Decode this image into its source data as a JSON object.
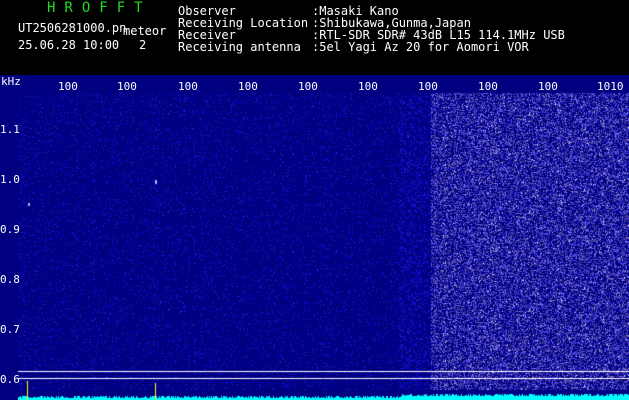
{
  "header": {
    "logo": "HROFFT",
    "filename": "UT2506281000.pn",
    "meteor_label": "meteor",
    "datetime": "25.06.28 10:00",
    "meteor_count": "2",
    "info": [
      {
        "label": "Observer",
        "value": ":Masaki Kano"
      },
      {
        "label": "Receiving Location",
        "value": ":Shibukawa,Gunma,Japan"
      },
      {
        "label": "Receiver",
        "value": ":RTL-SDR SDR# 43dB L15 114.1MHz USB"
      },
      {
        "label": "Receiving antenna",
        "value": ":5el Yagi Az 20 for Aomori VOR"
      }
    ]
  },
  "plot": {
    "unit_label": "kHz",
    "y_ticks": [
      "1.1",
      "1.0",
      "0.9",
      "0.8",
      "0.7",
      "0.6"
    ],
    "x_ticks": [
      "100",
      "100",
      "100",
      "100",
      "100",
      "100",
      "100",
      "100",
      "100",
      "1010"
    ],
    "colors": {
      "background": "#000080",
      "noise": "#3c46ff",
      "signal_line": "#ffffff",
      "amplitude": "#00ffff",
      "meteor_mark": "#ffff00"
    }
  }
}
